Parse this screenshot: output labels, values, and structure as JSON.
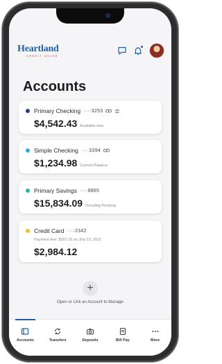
{
  "header": {
    "logo_main": "Heartland",
    "logo_sub": "CREDIT UNION",
    "icons": [
      "chat-icon",
      "bell-icon",
      "avatar"
    ]
  },
  "page": {
    "title": "Accounts"
  },
  "accounts": [
    {
      "name": "Primary Checking",
      "number": "····3253",
      "amount": "$4,542.43",
      "amount_label": "Available now",
      "dot_color": "#2b3a8c",
      "icons": [
        "link-icon",
        "transfer-icon"
      ]
    },
    {
      "name": "Simple Checking",
      "number": "····3394",
      "amount": "$1,234.98",
      "amount_label": "Current Balance",
      "dot_color": "#29a9e0",
      "icons": [
        "link-icon"
      ]
    },
    {
      "name": "Primary Savings",
      "number": "····9865",
      "amount": "$15,834.09",
      "amount_label": "Including Pending",
      "dot_color": "#2bb5a3",
      "icons": []
    },
    {
      "name": "Credit Card",
      "number": "····2342",
      "payment_due": "Payment due: $357.10 on July 13, 2021",
      "amount": "$2,984.12",
      "dot_color": "#f2c12e",
      "icons": []
    }
  ],
  "add_account": {
    "icon": "plus-icon",
    "label": "Open or Link an Account to Manage"
  },
  "tabs": [
    {
      "label": "Accounts",
      "icon": "accounts-icon",
      "active": true
    },
    {
      "label": "Transfers",
      "icon": "transfers-icon",
      "active": false
    },
    {
      "label": "Deposits",
      "icon": "camera-icon",
      "active": false
    },
    {
      "label": "Bill Pay",
      "icon": "bill-icon",
      "active": false
    },
    {
      "label": "More",
      "icon": "more-icon",
      "active": false
    }
  ],
  "colors": {
    "brand": "#1f5fa8",
    "accent_red": "#c0392b",
    "background": "#f5f5f7"
  }
}
